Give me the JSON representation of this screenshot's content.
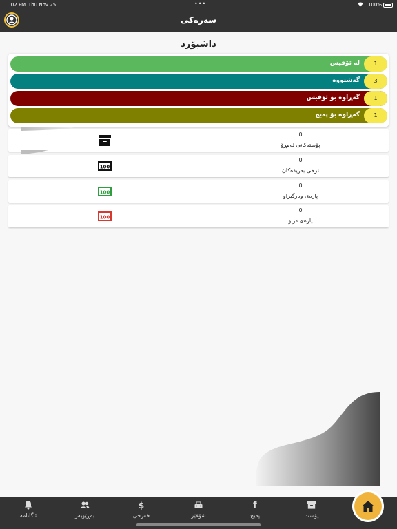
{
  "statusbar": {
    "time": "1:02 PM",
    "date": "Thu Nov 25",
    "battery": "100%"
  },
  "header": {
    "title": "سەرەکی"
  },
  "dashboard": {
    "title": "داشبۆرد",
    "statuses": [
      {
        "label": "لە ئۆفیس",
        "count": "1",
        "color": "#5cb85c"
      },
      {
        "label": "گەشتووە",
        "count": "3",
        "color": "#058080"
      },
      {
        "label": "گەڕاوە بۆ ئۆفیس",
        "count": "1",
        "color": "#800000"
      },
      {
        "label": "گەڕاوە بۆ پەیج",
        "count": "1",
        "color": "#808000"
      }
    ],
    "stats": [
      {
        "value": "0",
        "label": "پۆستەکانی ئەمڕۆ",
        "icon": "archive-box-icon",
        "icon_color": "#111111"
      },
      {
        "value": "0",
        "label": "نرخی بەریدەکان",
        "icon": "money-bill-icon",
        "icon_color": "#111111"
      },
      {
        "value": "0",
        "label": "پارەی وەرگیراو",
        "icon": "money-bill-icon",
        "icon_color": "#2e9e3e"
      },
      {
        "value": "0",
        "label": "پارەی دراو",
        "icon": "money-bill-icon",
        "icon_color": "#d9382f"
      }
    ]
  },
  "bottom_nav": {
    "items": [
      {
        "label": "ئاگانامە",
        "icon": "bell-icon"
      },
      {
        "label": "بەڕێوبەر",
        "icon": "users-icon"
      },
      {
        "label": "خەرجی",
        "icon": "dollar-icon"
      },
      {
        "label": "شۆفێر",
        "icon": "car-icon"
      },
      {
        "label": "پەیج",
        "icon": "facebook-icon"
      },
      {
        "label": "پۆست",
        "icon": "archive-icon"
      }
    ],
    "home_icon": "home-icon"
  }
}
